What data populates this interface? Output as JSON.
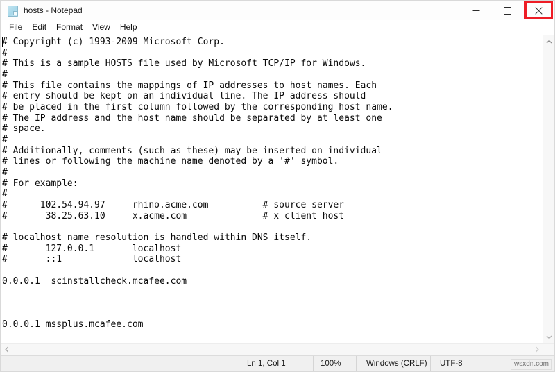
{
  "window": {
    "title": "hosts - Notepad",
    "icon": "notepad-document-icon"
  },
  "titlebar": {
    "minimize_label": "minimize-icon",
    "maximize_label": "maximize-icon",
    "close_label": "close-icon",
    "close_highlight_color": "#ee1c25"
  },
  "menubar": {
    "items": [
      {
        "label": "File"
      },
      {
        "label": "Edit"
      },
      {
        "label": "Format"
      },
      {
        "label": "View"
      },
      {
        "label": "Help"
      }
    ]
  },
  "editor": {
    "text": "# Copyright (c) 1993-2009 Microsoft Corp.\n#\n# This is a sample HOSTS file used by Microsoft TCP/IP for Windows.\n#\n# This file contains the mappings of IP addresses to host names. Each\n# entry should be kept on an individual line. The IP address should\n# be placed in the first column followed by the corresponding host name.\n# The IP address and the host name should be separated by at least one\n# space.\n#\n# Additionally, comments (such as these) may be inserted on individual\n# lines or following the machine name denoted by a '#' symbol.\n#\n# For example:\n#\n#      102.54.94.97     rhino.acme.com          # source server\n#       38.25.63.10     x.acme.com              # x client host\n\n# localhost name resolution is handled within DNS itself.\n#       127.0.0.1       localhost\n#       ::1             localhost\n\n0.0.0.1  scinstallcheck.mcafee.com\n\n\n\n0.0.0.1 mssplus.mcafee.com",
    "lines": [
      "# Copyright (c) 1993-2009 Microsoft Corp.",
      "#",
      "# This is a sample HOSTS file used by Microsoft TCP/IP for Windows.",
      "#",
      "# This file contains the mappings of IP addresses to host names. Each",
      "# entry should be kept on an individual line. The IP address should",
      "# be placed in the first column followed by the corresponding host name.",
      "# The IP address and the host name should be separated by at least one",
      "# space.",
      "#",
      "# Additionally, comments (such as these) may be inserted on individual",
      "# lines or following the machine name denoted by a '#' symbol.",
      "#",
      "# For example:",
      "#",
      "#      102.54.94.97     rhino.acme.com          # source server",
      "#       38.25.63.10     x.acme.com              # x client host",
      "",
      "# localhost name resolution is handled within DNS itself.",
      "#       127.0.0.1       localhost",
      "#       ::1             localhost",
      "",
      "0.0.0.1  scinstallcheck.mcafee.com",
      "",
      "",
      "",
      "0.0.0.1 mssplus.mcafee.com"
    ]
  },
  "scrollbars": {
    "vertical_up": "scroll-up-arrow-icon",
    "vertical_down": "scroll-down-arrow-icon",
    "horizontal_left": "scroll-left-arrow-icon",
    "horizontal_right": "scroll-right-arrow-icon"
  },
  "statusbar": {
    "cursor_position": "Ln 1, Col 1",
    "zoom": "100%",
    "line_endings": "Windows (CRLF)",
    "encoding": "UTF-8",
    "watermark": "wsxdn.com"
  }
}
